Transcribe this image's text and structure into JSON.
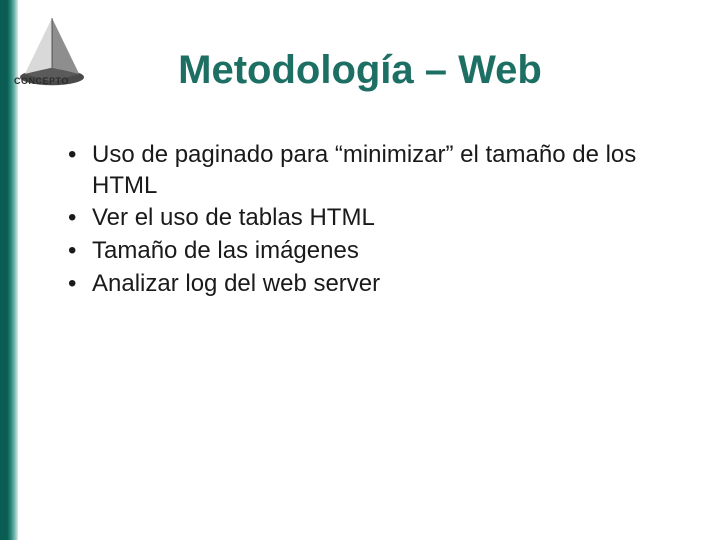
{
  "logo": {
    "brand_text": "CONCEPTO"
  },
  "title": "Metodología – Web",
  "bullets": [
    "Uso de paginado para “minimizar” el tamaño de los HTML",
    "Ver el uso de tablas HTML",
    "Tamaño de las imágenes",
    "Analizar log del web server"
  ]
}
